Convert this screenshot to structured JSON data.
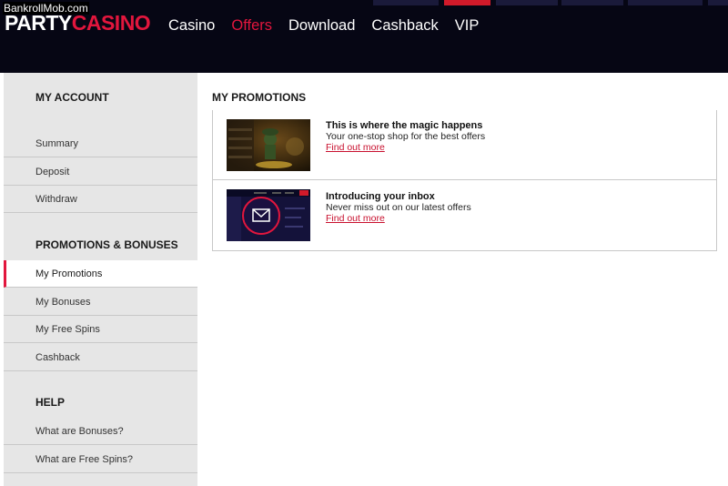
{
  "watermark": "BankrollMob.com",
  "logo": {
    "part1": "PARTY",
    "part2": "CASINO"
  },
  "nav": [
    {
      "label": "Casino",
      "active": false
    },
    {
      "label": "Offers",
      "active": true
    },
    {
      "label": "Download",
      "active": false
    },
    {
      "label": "Cashback",
      "active": false
    },
    {
      "label": "VIP",
      "active": false
    }
  ],
  "sidebar": {
    "my_account": {
      "title": "MY ACCOUNT",
      "items": [
        "Summary",
        "Deposit",
        "Withdraw"
      ]
    },
    "promotions": {
      "title": "PROMOTIONS & BONUSES",
      "items": [
        "My Promotions",
        "My Bonuses",
        "My Free Spins",
        "Cashback"
      ],
      "selected": "My Promotions"
    },
    "help": {
      "title": "HELP",
      "items": [
        "What are Bonuses?",
        "What are Free Spins?"
      ]
    }
  },
  "main": {
    "title": "MY PROMOTIONS",
    "promos": [
      {
        "title": "This is where the magic happens",
        "description": "Your one-stop shop for the best offers",
        "link": "Find out more",
        "thumb_icon": "leprechaun-image"
      },
      {
        "title": "Introducing your inbox",
        "description": "Never miss out on our latest offers",
        "link": "Find out more",
        "thumb_icon": "envelope-icon"
      }
    ]
  },
  "colors": {
    "accent": "#e2163d",
    "header_bg": "#060614",
    "sidebar_bg": "#e6e6e6",
    "link": "#c8102e"
  }
}
